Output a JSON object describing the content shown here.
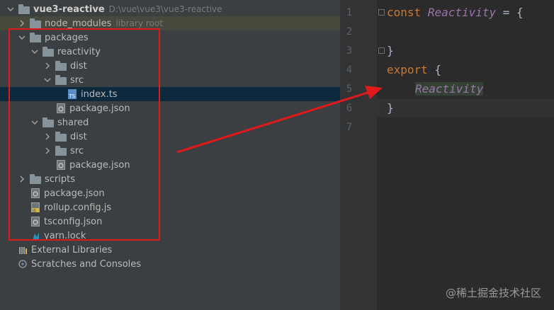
{
  "project": {
    "root_name": "vue3-reactive",
    "root_path": "D:\\vue\\vue3\\vue3-reactive"
  },
  "tree": {
    "node_modules": {
      "name": "node_modules",
      "hint": "library root"
    },
    "packages": "packages",
    "reactivity": "reactivity",
    "reactivity_dist": "dist",
    "reactivity_src": "src",
    "index_ts": "index.ts",
    "reactivity_package_json": "package.json",
    "shared": "shared",
    "shared_dist": "dist",
    "shared_src": "src",
    "shared_package_json": "package.json",
    "scripts": "scripts",
    "package_json": "package.json",
    "rollup_config": "rollup.config.js",
    "tsconfig": "tsconfig.json",
    "yarn_lock": "yarn.lock",
    "external_libraries": "External Libraries",
    "scratches": "Scratches and Consoles"
  },
  "editor": {
    "line_numbers": [
      "1",
      "2",
      "3",
      "4",
      "5",
      "6",
      "7"
    ],
    "line1_kw": "const",
    "line1_ident": "Reactivity",
    "line1_rest": " = {",
    "line3": "}",
    "line4_kw": "export",
    "line4_rest": " {",
    "line5": "Reactivity",
    "line6": "}"
  },
  "watermark": "@稀土掘金技术社区",
  "colors": {
    "highlight_box": "#e01a1a",
    "arrow": "#e01a1a",
    "selection": "#0d293e",
    "keyword": "#cc7832"
  }
}
